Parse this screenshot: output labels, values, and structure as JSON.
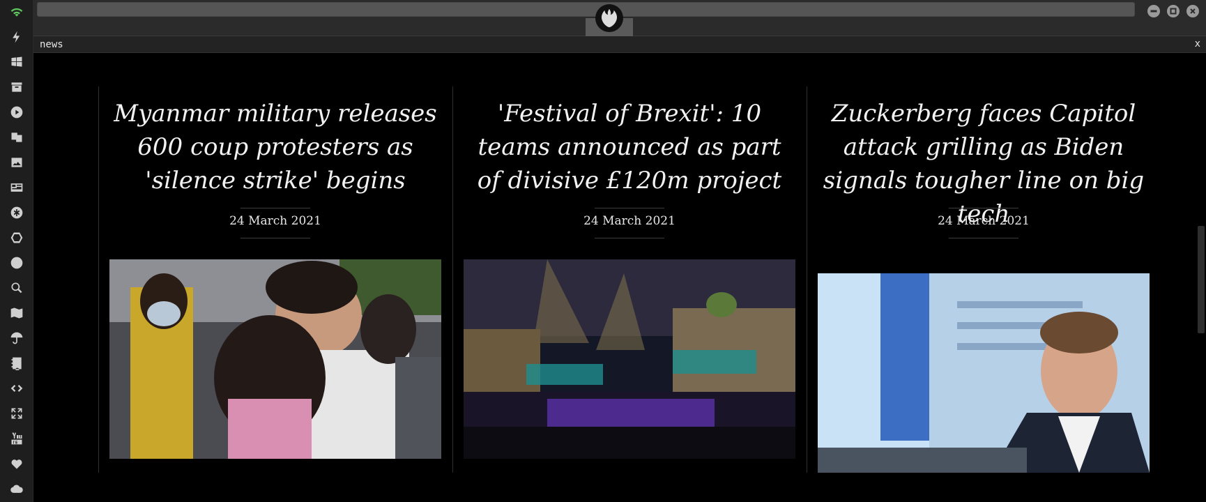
{
  "sidebar": {
    "items": [
      {
        "icon": "wifi-icon",
        "color": "#5fc65f"
      },
      {
        "icon": "lightning-icon"
      },
      {
        "icon": "windows-icon"
      },
      {
        "icon": "archive-icon"
      },
      {
        "icon": "play-icon"
      },
      {
        "icon": "translate-icon"
      },
      {
        "icon": "image-icon"
      },
      {
        "icon": "newspaper-icon"
      },
      {
        "icon": "asterisk-icon"
      },
      {
        "icon": "hexagon-icon"
      },
      {
        "icon": "globe-icon"
      },
      {
        "icon": "search-icon"
      },
      {
        "icon": "map-icon"
      },
      {
        "icon": "umbrella-icon"
      },
      {
        "icon": "contacts-icon"
      },
      {
        "icon": "code-icon"
      },
      {
        "icon": "expand-icon"
      },
      {
        "icon": "youtube-icon"
      },
      {
        "icon": "heart-icon"
      },
      {
        "icon": "cloud-icon"
      }
    ]
  },
  "window": {
    "emblem": "rebel-alliance-icon",
    "controls": [
      "minimize-icon",
      "maximize-icon",
      "close-icon"
    ]
  },
  "panel": {
    "title": "news",
    "close_label": "x"
  },
  "articles": [
    {
      "headline": "Myanmar military releases 600 coup protesters as 'silence strike' begins",
      "date": "24 March 2021",
      "image": "protesters-embracing-photo"
    },
    {
      "headline": "'Festival of Brexit': 10 teams announced as part of divisive £120m project",
      "date": "24 March 2021",
      "image": "festival-crowd-photo"
    },
    {
      "headline": "Zuckerberg faces Capitol attack grilling as Biden signals tougher line on big tech",
      "date": "24 March 2021",
      "image": "zuckerberg-hearing-photo"
    }
  ]
}
